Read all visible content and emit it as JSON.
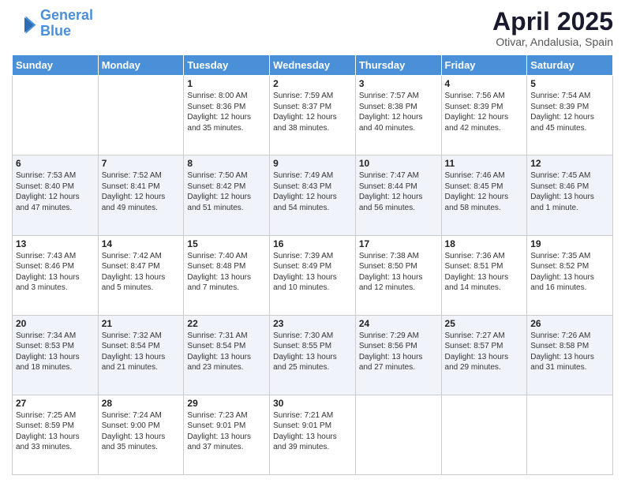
{
  "header": {
    "logo_line1": "General",
    "logo_line2": "Blue",
    "month": "April 2025",
    "location": "Otivar, Andalusia, Spain"
  },
  "days_of_week": [
    "Sunday",
    "Monday",
    "Tuesday",
    "Wednesday",
    "Thursday",
    "Friday",
    "Saturday"
  ],
  "weeks": [
    [
      {
        "day": "",
        "info": ""
      },
      {
        "day": "",
        "info": ""
      },
      {
        "day": "1",
        "info": "Sunrise: 8:00 AM\nSunset: 8:36 PM\nDaylight: 12 hours and 35 minutes."
      },
      {
        "day": "2",
        "info": "Sunrise: 7:59 AM\nSunset: 8:37 PM\nDaylight: 12 hours and 38 minutes."
      },
      {
        "day": "3",
        "info": "Sunrise: 7:57 AM\nSunset: 8:38 PM\nDaylight: 12 hours and 40 minutes."
      },
      {
        "day": "4",
        "info": "Sunrise: 7:56 AM\nSunset: 8:39 PM\nDaylight: 12 hours and 42 minutes."
      },
      {
        "day": "5",
        "info": "Sunrise: 7:54 AM\nSunset: 8:39 PM\nDaylight: 12 hours and 45 minutes."
      }
    ],
    [
      {
        "day": "6",
        "info": "Sunrise: 7:53 AM\nSunset: 8:40 PM\nDaylight: 12 hours and 47 minutes."
      },
      {
        "day": "7",
        "info": "Sunrise: 7:52 AM\nSunset: 8:41 PM\nDaylight: 12 hours and 49 minutes."
      },
      {
        "day": "8",
        "info": "Sunrise: 7:50 AM\nSunset: 8:42 PM\nDaylight: 12 hours and 51 minutes."
      },
      {
        "day": "9",
        "info": "Sunrise: 7:49 AM\nSunset: 8:43 PM\nDaylight: 12 hours and 54 minutes."
      },
      {
        "day": "10",
        "info": "Sunrise: 7:47 AM\nSunset: 8:44 PM\nDaylight: 12 hours and 56 minutes."
      },
      {
        "day": "11",
        "info": "Sunrise: 7:46 AM\nSunset: 8:45 PM\nDaylight: 12 hours and 58 minutes."
      },
      {
        "day": "12",
        "info": "Sunrise: 7:45 AM\nSunset: 8:46 PM\nDaylight: 13 hours and 1 minute."
      }
    ],
    [
      {
        "day": "13",
        "info": "Sunrise: 7:43 AM\nSunset: 8:46 PM\nDaylight: 13 hours and 3 minutes."
      },
      {
        "day": "14",
        "info": "Sunrise: 7:42 AM\nSunset: 8:47 PM\nDaylight: 13 hours and 5 minutes."
      },
      {
        "day": "15",
        "info": "Sunrise: 7:40 AM\nSunset: 8:48 PM\nDaylight: 13 hours and 7 minutes."
      },
      {
        "day": "16",
        "info": "Sunrise: 7:39 AM\nSunset: 8:49 PM\nDaylight: 13 hours and 10 minutes."
      },
      {
        "day": "17",
        "info": "Sunrise: 7:38 AM\nSunset: 8:50 PM\nDaylight: 13 hours and 12 minutes."
      },
      {
        "day": "18",
        "info": "Sunrise: 7:36 AM\nSunset: 8:51 PM\nDaylight: 13 hours and 14 minutes."
      },
      {
        "day": "19",
        "info": "Sunrise: 7:35 AM\nSunset: 8:52 PM\nDaylight: 13 hours and 16 minutes."
      }
    ],
    [
      {
        "day": "20",
        "info": "Sunrise: 7:34 AM\nSunset: 8:53 PM\nDaylight: 13 hours and 18 minutes."
      },
      {
        "day": "21",
        "info": "Sunrise: 7:32 AM\nSunset: 8:54 PM\nDaylight: 13 hours and 21 minutes."
      },
      {
        "day": "22",
        "info": "Sunrise: 7:31 AM\nSunset: 8:54 PM\nDaylight: 13 hours and 23 minutes."
      },
      {
        "day": "23",
        "info": "Sunrise: 7:30 AM\nSunset: 8:55 PM\nDaylight: 13 hours and 25 minutes."
      },
      {
        "day": "24",
        "info": "Sunrise: 7:29 AM\nSunset: 8:56 PM\nDaylight: 13 hours and 27 minutes."
      },
      {
        "day": "25",
        "info": "Sunrise: 7:27 AM\nSunset: 8:57 PM\nDaylight: 13 hours and 29 minutes."
      },
      {
        "day": "26",
        "info": "Sunrise: 7:26 AM\nSunset: 8:58 PM\nDaylight: 13 hours and 31 minutes."
      }
    ],
    [
      {
        "day": "27",
        "info": "Sunrise: 7:25 AM\nSunset: 8:59 PM\nDaylight: 13 hours and 33 minutes."
      },
      {
        "day": "28",
        "info": "Sunrise: 7:24 AM\nSunset: 9:00 PM\nDaylight: 13 hours and 35 minutes."
      },
      {
        "day": "29",
        "info": "Sunrise: 7:23 AM\nSunset: 9:01 PM\nDaylight: 13 hours and 37 minutes."
      },
      {
        "day": "30",
        "info": "Sunrise: 7:21 AM\nSunset: 9:01 PM\nDaylight: 13 hours and 39 minutes."
      },
      {
        "day": "",
        "info": ""
      },
      {
        "day": "",
        "info": ""
      },
      {
        "day": "",
        "info": ""
      }
    ]
  ]
}
